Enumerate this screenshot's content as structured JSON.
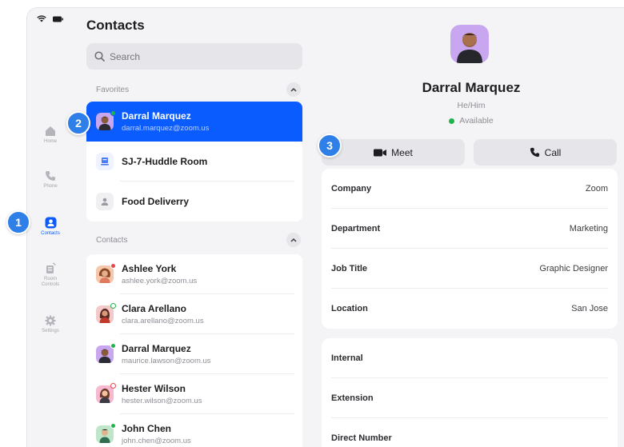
{
  "rail": {
    "items": [
      {
        "label": "Home",
        "icon": "home-icon"
      },
      {
        "label": "Phone",
        "icon": "phone-icon"
      },
      {
        "label": "Contacts",
        "icon": "contacts-icon"
      },
      {
        "label_line1": "Room",
        "label_line2": "Controls",
        "icon": "room-controls-icon"
      },
      {
        "label": "Settings",
        "icon": "gear-icon"
      }
    ],
    "active_color": "#0b5cff"
  },
  "contacts_panel": {
    "title": "Contacts",
    "search_placeholder": "Search",
    "favorites_label": "Favorites",
    "contacts_label": "Contacts",
    "favorites": [
      {
        "name": "Darral Marquez",
        "email": "darral.marquez@zoom.us",
        "selected": true
      },
      {
        "name": "SJ-7-Huddle Room",
        "icon": "room-icon"
      },
      {
        "name": "Food Deliverry",
        "icon": "person-icon"
      }
    ],
    "contacts": [
      {
        "name": "Ashlee York",
        "email": "ashlee.york@zoom.us",
        "status": "busy"
      },
      {
        "name": "Clara Arellano",
        "email": "clara.arellano@zoom.us",
        "status": "away"
      },
      {
        "name": "Darral Marquez",
        "email": "maurice.lawson@zoom.us",
        "status": "available"
      },
      {
        "name": "Hester Wilson",
        "email": "hester.wilson@zoom.us",
        "status": "on-call"
      },
      {
        "name": "John Chen",
        "email": "john.chen@zoom.us",
        "status": "available"
      }
    ]
  },
  "detail": {
    "name": "Darral Marquez",
    "pronouns": "He/Him",
    "status": "Available",
    "meet_label": "Meet",
    "call_label": "Call",
    "fields": [
      {
        "key": "Company",
        "value": "Zoom"
      },
      {
        "key": "Department",
        "value": "Marketing"
      },
      {
        "key": "Job Title",
        "value": "Graphic Designer"
      },
      {
        "key": "Location",
        "value": "San Jose"
      }
    ],
    "phone_fields": [
      {
        "key": "Internal"
      },
      {
        "key": "Extension"
      },
      {
        "key": "Direct Number"
      }
    ]
  },
  "badges": [
    "1",
    "2",
    "3"
  ],
  "colors": {
    "accent": "#0b5cff",
    "badge": "#2f7fe8",
    "available": "#1fb44b"
  }
}
